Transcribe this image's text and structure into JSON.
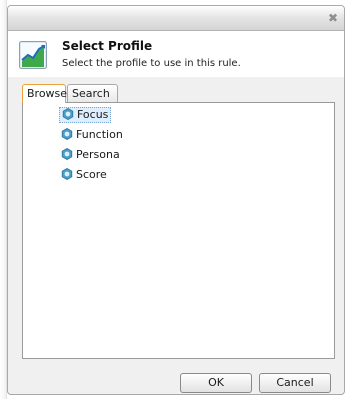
{
  "dialog": {
    "close_icon": "close-icon",
    "close_glyph": "✖"
  },
  "header": {
    "icon": "profile-chart-icon",
    "title": "Select Profile",
    "subtitle": "Select the profile to use in this rule."
  },
  "tabs": [
    {
      "label": "Browse",
      "active": true
    },
    {
      "label": "Search",
      "active": false
    }
  ],
  "tree": {
    "node_icon": "profile-node-icon",
    "items": [
      {
        "label": "Focus",
        "selected": true
      },
      {
        "label": "Function",
        "selected": false
      },
      {
        "label": "Persona",
        "selected": false
      },
      {
        "label": "Score",
        "selected": false
      }
    ]
  },
  "buttons": {
    "ok_label": "OK",
    "cancel_label": "Cancel"
  },
  "colors": {
    "active_tab_border": "#e8a23a",
    "selection_fill": "#ddeeff",
    "node_icon_fill": "#4a9ec8"
  }
}
